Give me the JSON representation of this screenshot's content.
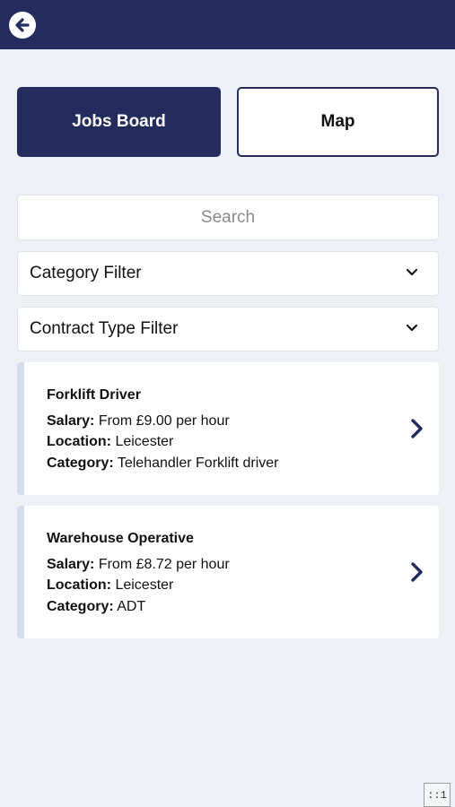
{
  "header": {
    "back_icon": "back-arrow-circle-icon"
  },
  "tabs": {
    "jobs_board": "Jobs Board",
    "map": "Map",
    "active": "Jobs Board"
  },
  "search": {
    "placeholder": "Search",
    "value": ""
  },
  "filters": {
    "category": "Category Filter",
    "contract_type": "Contract Type Filter"
  },
  "jobs": [
    {
      "title": "Forklift Driver",
      "salary_label": "Salary:",
      "salary": "From £9.00 per hour",
      "location_label": "Location:",
      "location": "Leicester",
      "category_label": "Category:",
      "category": "Telehandler Forklift driver"
    },
    {
      "title": "Warehouse Operative",
      "salary_label": "Salary:",
      "salary": "From £8.72 per hour",
      "location_label": "Location:",
      "location": "Leicester",
      "category_label": "Category:",
      "category": "ADT"
    }
  ],
  "corner_badge": "::1",
  "colors": {
    "primary": "#232c5c",
    "background": "#edf0f5",
    "card_accent": "#d5dcea"
  }
}
